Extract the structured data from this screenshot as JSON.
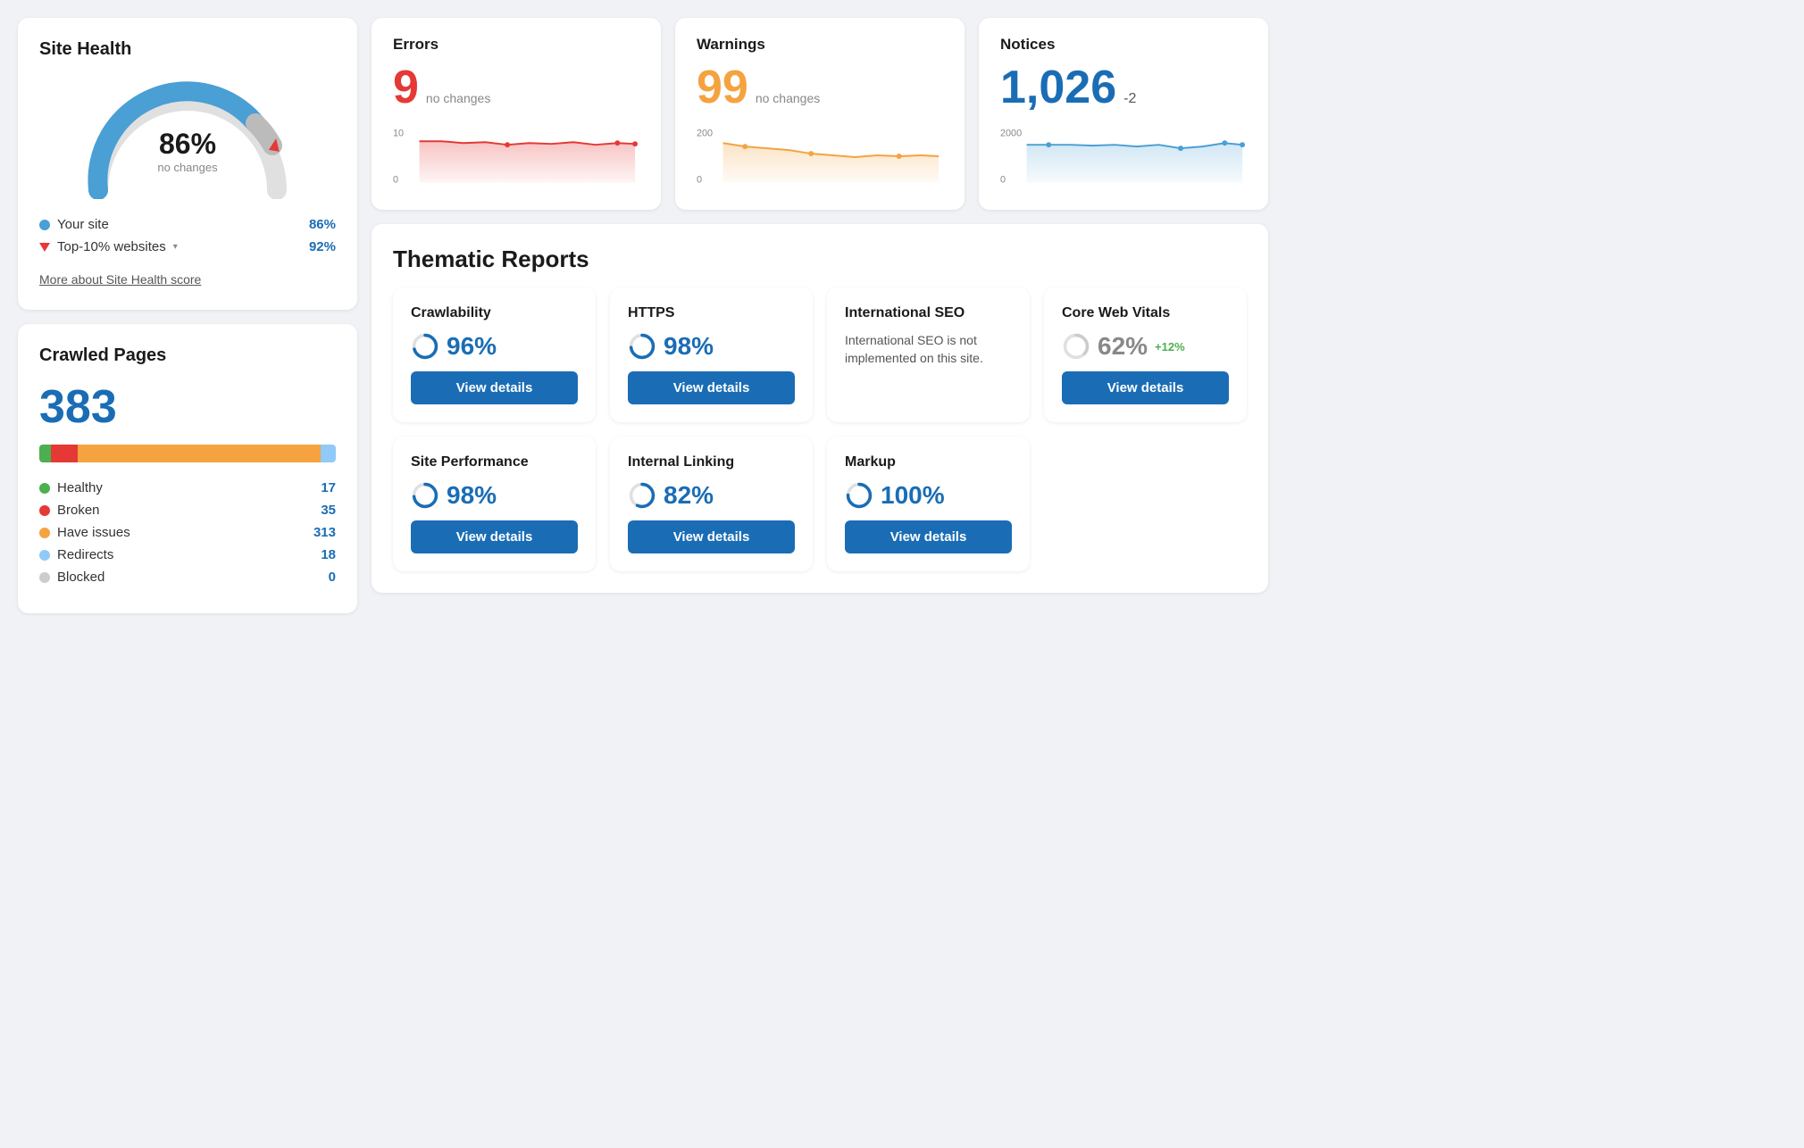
{
  "site_health": {
    "title": "Site Health",
    "percent": "86%",
    "sub": "no changes",
    "your_site_label": "Your site",
    "your_site_value": "86%",
    "top10_label": "Top-10% websites",
    "top10_value": "92%",
    "more_link": "More about Site Health score",
    "gauge_blue_deg": 220,
    "gauge_gray_deg": 30
  },
  "crawled_pages": {
    "title": "Crawled Pages",
    "count": "383",
    "healthy_label": "Healthy",
    "healthy_value": "17",
    "broken_label": "Broken",
    "broken_value": "35",
    "have_issues_label": "Have issues",
    "have_issues_value": "313",
    "redirects_label": "Redirects",
    "redirects_value": "18",
    "blocked_label": "Blocked",
    "blocked_value": "0",
    "bar": {
      "green_pct": 4,
      "red_pct": 9,
      "orange_pct": 82,
      "lightblue_pct": 5
    }
  },
  "errors": {
    "label": "Errors",
    "value": "9",
    "change": "no changes",
    "chart_max": "10",
    "chart_min": "0"
  },
  "warnings": {
    "label": "Warnings",
    "value": "99",
    "change": "no changes",
    "chart_max": "200",
    "chart_min": "0"
  },
  "notices": {
    "label": "Notices",
    "value": "1,026",
    "change": "-2",
    "chart_max": "2000",
    "chart_min": "0"
  },
  "thematic": {
    "title": "Thematic Reports",
    "reports_row1": [
      {
        "id": "crawlability",
        "title": "Crawlability",
        "score": "96%",
        "change": "",
        "btn": "View details",
        "note": "",
        "score_color": "blue",
        "circ_color": "#1a6db5",
        "circ_pct": 96
      },
      {
        "id": "https",
        "title": "HTTPS",
        "score": "98%",
        "change": "",
        "btn": "View details",
        "note": "",
        "score_color": "blue",
        "circ_color": "#1a6db5",
        "circ_pct": 98
      },
      {
        "id": "international-seo",
        "title": "International SEO",
        "score": "",
        "change": "",
        "btn": "",
        "note": "International SEO is not implemented on this site.",
        "score_color": "blue",
        "circ_color": "#ccc",
        "circ_pct": 0
      },
      {
        "id": "core-web-vitals",
        "title": "Core Web Vitals",
        "score": "62%",
        "change": "+12%",
        "btn": "View details",
        "note": "",
        "score_color": "gray",
        "circ_color": "#ccc",
        "circ_pct": 62
      }
    ],
    "reports_row2": [
      {
        "id": "site-performance",
        "title": "Site Performance",
        "score": "98%",
        "change": "",
        "btn": "View details",
        "note": "",
        "score_color": "blue",
        "circ_color": "#1a6db5",
        "circ_pct": 98
      },
      {
        "id": "internal-linking",
        "title": "Internal Linking",
        "score": "82%",
        "change": "",
        "btn": "View details",
        "note": "",
        "score_color": "blue",
        "circ_color": "#1a6db5",
        "circ_pct": 82
      },
      {
        "id": "markup",
        "title": "Markup",
        "score": "100%",
        "change": "",
        "btn": "View details",
        "note": "",
        "score_color": "blue",
        "circ_color": "#1a6db5",
        "circ_pct": 100
      }
    ]
  }
}
